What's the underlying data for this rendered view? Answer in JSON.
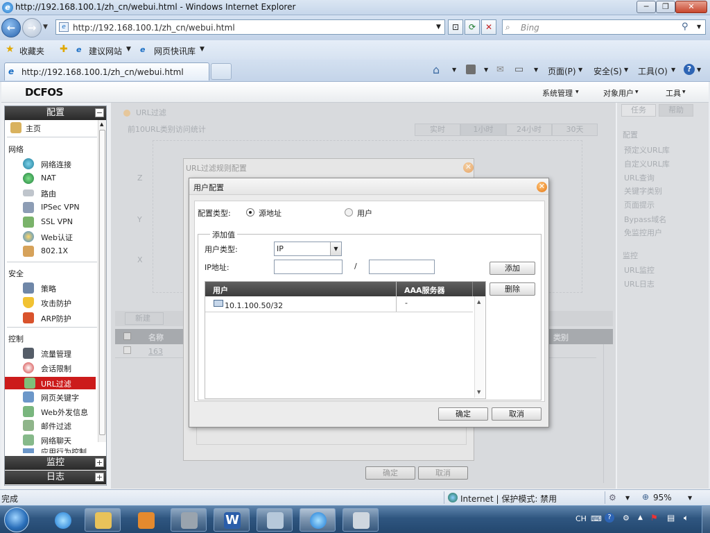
{
  "window": {
    "title": "http://192.168.100.1/zh_cn/webui.html - Windows Internet Explorer",
    "min": "─",
    "max": "❐",
    "close": "✕"
  },
  "nav": {
    "address": "http://192.168.100.1/zh_cn/webui.html",
    "search_placeholder": "Bing"
  },
  "favbar": {
    "favorites": "收藏夹",
    "suggested": "建议网站",
    "webslices": "网页快讯库"
  },
  "tab": {
    "title": "http://192.168.100.1/zh_cn/webui.html"
  },
  "commandbar": {
    "page": "页面(P)",
    "safety": "安全(S)",
    "tools": "工具(O)",
    "help": "?"
  },
  "app": {
    "logo": "DCFOS",
    "menu": {
      "system": "系统管理",
      "objects": "对象用户",
      "tools": "工具"
    }
  },
  "sidebar": {
    "config_header": "配置",
    "monitor_header": "监控",
    "log_header": "日志",
    "home": "主页",
    "sections": {
      "network": "网络",
      "security": "安全",
      "control": "控制"
    },
    "network_items": [
      "网络连接",
      "NAT",
      "路由",
      "IPSec VPN",
      "SSL VPN",
      "Web认证",
      "802.1X"
    ],
    "security_items": [
      "策略",
      "攻击防护",
      "ARP防护"
    ],
    "control_items": [
      "流量管理",
      "会话限制",
      "URL过滤",
      "网页关键字",
      "Web外发信息",
      "邮件过滤",
      "网络聊天",
      "应用行为控制"
    ],
    "selected": "URL过滤"
  },
  "main": {
    "title": "URL过滤",
    "chart_caption": "前10URL类别访问统计",
    "time_tabs": [
      "实时",
      "1小时",
      "24小时",
      "30天"
    ],
    "axis_labels": [
      "Z",
      "Y",
      "X"
    ],
    "new_btn": "新建",
    "table_headers": [
      "名称",
      "类别"
    ],
    "table_row": "163"
  },
  "rightpane": {
    "tab_tasks": "任务",
    "tab_help": "帮助",
    "config_label": "配置",
    "config_links": [
      "预定义URL库",
      "自定义URL库",
      "URL查询",
      "关键字类别",
      "页面提示",
      "Bypass域名",
      "免监控用户"
    ],
    "monitor_label": "监控",
    "monitor_links": [
      "URL监控",
      "URL日志"
    ]
  },
  "rule_dialog": {
    "title": "URL过滤规则配置",
    "ok": "确定",
    "cancel": "取消"
  },
  "user_dialog": {
    "title": "用户配置",
    "config_type_label": "配置类型:",
    "opt_source": "源地址",
    "opt_user": "用户",
    "group_label": "添加值",
    "user_type_label": "用户类型:",
    "user_type_value": "IP",
    "ip_label": "IP地址:",
    "ip_value": "",
    "mask_value": "",
    "slash": "/",
    "add_btn": "添加",
    "delete_btn": "删除",
    "col_user": "用户",
    "col_aaa": "AAA服务器",
    "rows": [
      {
        "user": "10.1.100.50/32",
        "aaa": "-"
      }
    ],
    "ok": "确定",
    "cancel": "取消"
  },
  "statusbar": {
    "text": "完成",
    "zone": "Internet | 保护模式: 禁用",
    "zoom": "95%"
  },
  "taskbar": {
    "lang": "CH"
  }
}
